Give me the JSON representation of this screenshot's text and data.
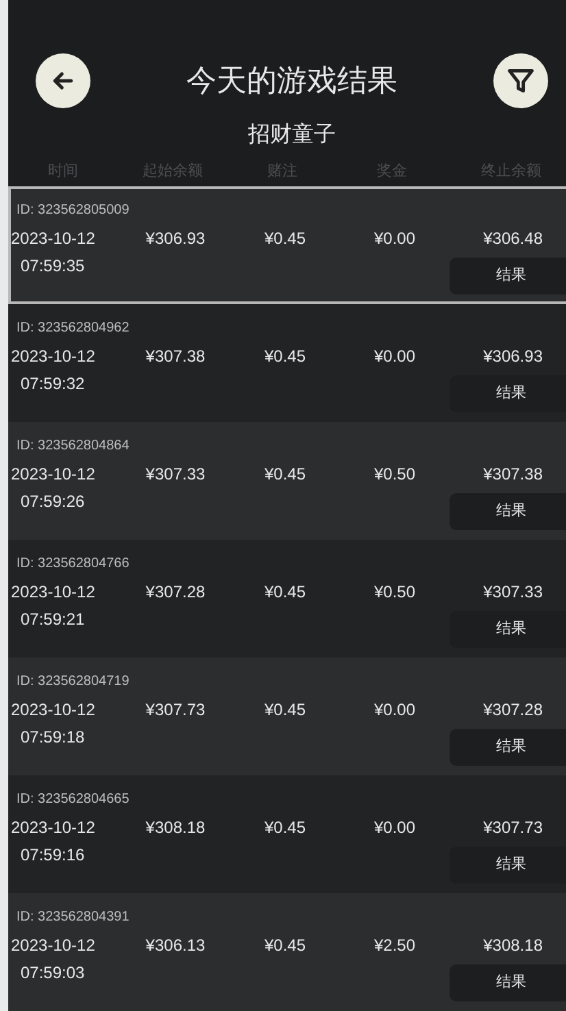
{
  "header": {
    "title": "今天的游戏结果",
    "subtitle": "招财童子"
  },
  "columns": [
    "时间",
    "起始余额",
    "赌注",
    "奖金",
    "终止余额"
  ],
  "rows": [
    {
      "id": "ID:  323562805009",
      "date": "2023-10-12",
      "time": "07:59:35",
      "start": "¥306.93",
      "bet": "¥0.45",
      "prize": "¥0.00",
      "end": "¥306.48",
      "button": "结果",
      "selected": true
    },
    {
      "id": "ID:  323562804962",
      "date": "2023-10-12",
      "time": "07:59:32",
      "start": "¥307.38",
      "bet": "¥0.45",
      "prize": "¥0.00",
      "end": "¥306.93",
      "button": "结果",
      "selected": false
    },
    {
      "id": "ID:  323562804864",
      "date": "2023-10-12",
      "time": "07:59:26",
      "start": "¥307.33",
      "bet": "¥0.45",
      "prize": "¥0.50",
      "end": "¥307.38",
      "button": "结果",
      "selected": false
    },
    {
      "id": "ID:  323562804766",
      "date": "2023-10-12",
      "time": "07:59:21",
      "start": "¥307.28",
      "bet": "¥0.45",
      "prize": "¥0.50",
      "end": "¥307.33",
      "button": "结果",
      "selected": false
    },
    {
      "id": "ID:  323562804719",
      "date": "2023-10-12",
      "time": "07:59:18",
      "start": "¥307.73",
      "bet": "¥0.45",
      "prize": "¥0.00",
      "end": "¥307.28",
      "button": "结果",
      "selected": false
    },
    {
      "id": "ID:  323562804665",
      "date": "2023-10-12",
      "time": "07:59:16",
      "start": "¥308.18",
      "bet": "¥0.45",
      "prize": "¥0.00",
      "end": "¥307.73",
      "button": "结果",
      "selected": false
    },
    {
      "id": "ID:  323562804391",
      "date": "2023-10-12",
      "time": "07:59:03",
      "start": "¥306.13",
      "bet": "¥0.45",
      "prize": "¥2.50",
      "end": "¥308.18",
      "button": "结果",
      "selected": false
    }
  ]
}
